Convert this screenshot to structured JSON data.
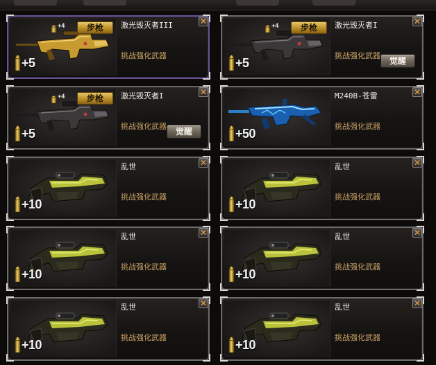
{
  "subtitle_text": "挑战强化武器",
  "close_glyph": "✕",
  "awaken_label": "觉醒",
  "cards": [
    {
      "name": "激光毁灭者III",
      "category": "步枪",
      "ammo_badge": "+4",
      "bonus": "+5",
      "gun": "laser-gold",
      "selected": true,
      "awaken": false
    },
    {
      "name": "激光毁灭者I",
      "category": "步枪",
      "ammo_badge": "+4",
      "bonus": "+5",
      "gun": "laser-dark",
      "selected": false,
      "awaken": true
    },
    {
      "name": "激光毁灭者I",
      "category": "步枪",
      "ammo_badge": "+4",
      "bonus": "+5",
      "gun": "laser-dark",
      "selected": false,
      "awaken": true
    },
    {
      "name": "M240B-苍雷",
      "category": "",
      "ammo_badge": "",
      "bonus": "+50",
      "gun": "mg-blue",
      "selected": false,
      "awaken": false
    },
    {
      "name": "乱世",
      "category": "",
      "ammo_badge": "",
      "bonus": "+10",
      "gun": "p90",
      "selected": false,
      "awaken": false
    },
    {
      "name": "乱世",
      "category": "",
      "ammo_badge": "",
      "bonus": "+10",
      "gun": "p90",
      "selected": false,
      "awaken": false
    },
    {
      "name": "乱世",
      "category": "",
      "ammo_badge": "",
      "bonus": "+10",
      "gun": "p90",
      "selected": false,
      "awaken": false
    },
    {
      "name": "乱世",
      "category": "",
      "ammo_badge": "",
      "bonus": "+10",
      "gun": "p90",
      "selected": false,
      "awaken": false
    },
    {
      "name": "乱世",
      "category": "",
      "ammo_badge": "",
      "bonus": "+10",
      "gun": "p90",
      "selected": false,
      "awaken": false
    },
    {
      "name": "乱世",
      "category": "",
      "ammo_badge": "",
      "bonus": "+10",
      "gun": "p90",
      "selected": false,
      "awaken": false
    }
  ]
}
